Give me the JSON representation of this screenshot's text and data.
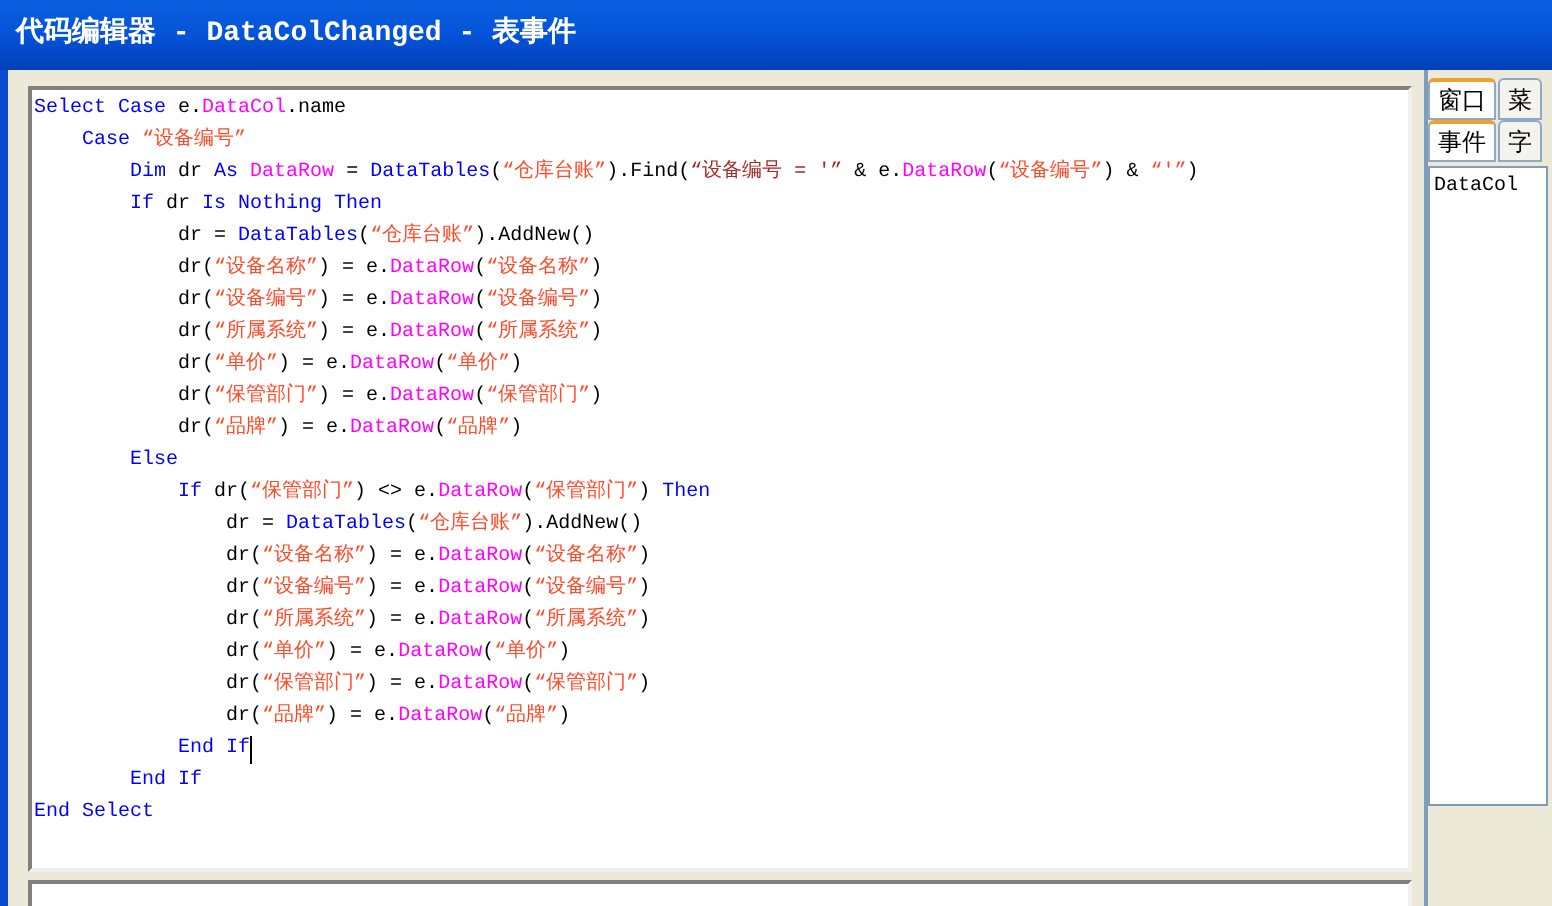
{
  "window": {
    "title": "代码编辑器 - DataColChanged - 表事件"
  },
  "code": [
    {
      "tokens": [
        {
          "kind": "kw",
          "text": "Select Case"
        },
        {
          "kind": "plain",
          "text": " e."
        },
        {
          "kind": "type",
          "text": "DataCol"
        },
        {
          "kind": "plain",
          "text": ".name"
        }
      ]
    },
    {
      "tokens": [
        {
          "kind": "kw",
          "text": "    Case "
        },
        {
          "kind": "str",
          "text": "“设备编号”"
        }
      ]
    },
    {
      "tokens": [
        {
          "kind": "kw",
          "text": "        Dim"
        },
        {
          "kind": "plain",
          "text": " dr "
        },
        {
          "kind": "kw",
          "text": "As "
        },
        {
          "kind": "type",
          "text": "DataRow"
        },
        {
          "kind": "plain",
          "text": " = "
        },
        {
          "kind": "kw",
          "text": "DataTables"
        },
        {
          "kind": "plain",
          "text": "("
        },
        {
          "kind": "str",
          "text": "“仓库台账”"
        },
        {
          "kind": "plain",
          "text": ").Find("
        },
        {
          "kind": "str2",
          "text": "“设备编号 = '”"
        },
        {
          "kind": "plain",
          "text": " & e."
        },
        {
          "kind": "type",
          "text": "DataRow"
        },
        {
          "kind": "plain",
          "text": "("
        },
        {
          "kind": "str",
          "text": "“设备编号”"
        },
        {
          "kind": "plain",
          "text": ") & "
        },
        {
          "kind": "str",
          "text": "“'”"
        },
        {
          "kind": "plain",
          "text": ")"
        }
      ]
    },
    {
      "tokens": [
        {
          "kind": "kw",
          "text": "        If"
        },
        {
          "kind": "plain",
          "text": " dr "
        },
        {
          "kind": "kw",
          "text": "Is Nothing Then"
        }
      ]
    },
    {
      "tokens": [
        {
          "kind": "plain",
          "text": "            dr = "
        },
        {
          "kind": "kw",
          "text": "DataTables"
        },
        {
          "kind": "plain",
          "text": "("
        },
        {
          "kind": "str",
          "text": "“仓库台账”"
        },
        {
          "kind": "plain",
          "text": ").AddNew()"
        }
      ]
    },
    {
      "tokens": [
        {
          "kind": "plain",
          "text": "            dr("
        },
        {
          "kind": "str",
          "text": "“设备名称”"
        },
        {
          "kind": "plain",
          "text": ") = e."
        },
        {
          "kind": "type",
          "text": "DataRow"
        },
        {
          "kind": "plain",
          "text": "("
        },
        {
          "kind": "str",
          "text": "“设备名称”"
        },
        {
          "kind": "plain",
          "text": ")"
        }
      ]
    },
    {
      "tokens": [
        {
          "kind": "plain",
          "text": "            dr("
        },
        {
          "kind": "str",
          "text": "“设备编号”"
        },
        {
          "kind": "plain",
          "text": ") = e."
        },
        {
          "kind": "type",
          "text": "DataRow"
        },
        {
          "kind": "plain",
          "text": "("
        },
        {
          "kind": "str",
          "text": "“设备编号”"
        },
        {
          "kind": "plain",
          "text": ")"
        }
      ]
    },
    {
      "tokens": [
        {
          "kind": "plain",
          "text": "            dr("
        },
        {
          "kind": "str",
          "text": "“所属系统”"
        },
        {
          "kind": "plain",
          "text": ") = e."
        },
        {
          "kind": "type",
          "text": "DataRow"
        },
        {
          "kind": "plain",
          "text": "("
        },
        {
          "kind": "str",
          "text": "“所属系统”"
        },
        {
          "kind": "plain",
          "text": ")"
        }
      ]
    },
    {
      "tokens": [
        {
          "kind": "plain",
          "text": "            dr("
        },
        {
          "kind": "str",
          "text": "“单价”"
        },
        {
          "kind": "plain",
          "text": ") = e."
        },
        {
          "kind": "type",
          "text": "DataRow"
        },
        {
          "kind": "plain",
          "text": "("
        },
        {
          "kind": "str",
          "text": "“单价”"
        },
        {
          "kind": "plain",
          "text": ")"
        }
      ]
    },
    {
      "tokens": [
        {
          "kind": "plain",
          "text": "            dr("
        },
        {
          "kind": "str",
          "text": "“保管部门”"
        },
        {
          "kind": "plain",
          "text": ") = e."
        },
        {
          "kind": "type",
          "text": "DataRow"
        },
        {
          "kind": "plain",
          "text": "("
        },
        {
          "kind": "str",
          "text": "“保管部门”"
        },
        {
          "kind": "plain",
          "text": ")"
        }
      ]
    },
    {
      "tokens": [
        {
          "kind": "plain",
          "text": "            dr("
        },
        {
          "kind": "str",
          "text": "“品牌”"
        },
        {
          "kind": "plain",
          "text": ") = e."
        },
        {
          "kind": "type",
          "text": "DataRow"
        },
        {
          "kind": "plain",
          "text": "("
        },
        {
          "kind": "str",
          "text": "“品牌”"
        },
        {
          "kind": "plain",
          "text": ")"
        }
      ]
    },
    {
      "tokens": [
        {
          "kind": "kw",
          "text": "        Else"
        }
      ]
    },
    {
      "tokens": [
        {
          "kind": "kw",
          "text": "            If"
        },
        {
          "kind": "plain",
          "text": " dr("
        },
        {
          "kind": "str",
          "text": "“保管部门”"
        },
        {
          "kind": "plain",
          "text": ") <> e."
        },
        {
          "kind": "type",
          "text": "DataRow"
        },
        {
          "kind": "plain",
          "text": "("
        },
        {
          "kind": "str",
          "text": "“保管部门”"
        },
        {
          "kind": "plain",
          "text": ") "
        },
        {
          "kind": "kw",
          "text": "Then"
        }
      ]
    },
    {
      "tokens": [
        {
          "kind": "plain",
          "text": "                dr = "
        },
        {
          "kind": "kw",
          "text": "DataTables"
        },
        {
          "kind": "plain",
          "text": "("
        },
        {
          "kind": "str",
          "text": "“仓库台账”"
        },
        {
          "kind": "plain",
          "text": ").AddNew()"
        }
      ]
    },
    {
      "tokens": [
        {
          "kind": "plain",
          "text": "                dr("
        },
        {
          "kind": "str",
          "text": "“设备名称”"
        },
        {
          "kind": "plain",
          "text": ") = e."
        },
        {
          "kind": "type",
          "text": "DataRow"
        },
        {
          "kind": "plain",
          "text": "("
        },
        {
          "kind": "str",
          "text": "“设备名称”"
        },
        {
          "kind": "plain",
          "text": ")"
        }
      ]
    },
    {
      "tokens": [
        {
          "kind": "plain",
          "text": "                dr("
        },
        {
          "kind": "str",
          "text": "“设备编号”"
        },
        {
          "kind": "plain",
          "text": ") = e."
        },
        {
          "kind": "type",
          "text": "DataRow"
        },
        {
          "kind": "plain",
          "text": "("
        },
        {
          "kind": "str",
          "text": "“设备编号”"
        },
        {
          "kind": "plain",
          "text": ")"
        }
      ]
    },
    {
      "tokens": [
        {
          "kind": "plain",
          "text": "                dr("
        },
        {
          "kind": "str",
          "text": "“所属系统”"
        },
        {
          "kind": "plain",
          "text": ") = e."
        },
        {
          "kind": "type",
          "text": "DataRow"
        },
        {
          "kind": "plain",
          "text": "("
        },
        {
          "kind": "str",
          "text": "“所属系统”"
        },
        {
          "kind": "plain",
          "text": ")"
        }
      ]
    },
    {
      "tokens": [
        {
          "kind": "plain",
          "text": "                dr("
        },
        {
          "kind": "str",
          "text": "“单价”"
        },
        {
          "kind": "plain",
          "text": ") = e."
        },
        {
          "kind": "type",
          "text": "DataRow"
        },
        {
          "kind": "plain",
          "text": "("
        },
        {
          "kind": "str",
          "text": "“单价”"
        },
        {
          "kind": "plain",
          "text": ")"
        }
      ]
    },
    {
      "tokens": [
        {
          "kind": "plain",
          "text": "                dr("
        },
        {
          "kind": "str",
          "text": "“保管部门”"
        },
        {
          "kind": "plain",
          "text": ") = e."
        },
        {
          "kind": "type",
          "text": "DataRow"
        },
        {
          "kind": "plain",
          "text": "("
        },
        {
          "kind": "str",
          "text": "“保管部门”"
        },
        {
          "kind": "plain",
          "text": ")"
        }
      ]
    },
    {
      "tokens": [
        {
          "kind": "plain",
          "text": "                dr("
        },
        {
          "kind": "str",
          "text": "“品牌”"
        },
        {
          "kind": "plain",
          "text": ") = e."
        },
        {
          "kind": "type",
          "text": "DataRow"
        },
        {
          "kind": "plain",
          "text": "("
        },
        {
          "kind": "str",
          "text": "“品牌”"
        },
        {
          "kind": "plain",
          "text": ")"
        }
      ]
    },
    {
      "tokens": [
        {
          "kind": "kw",
          "text": "            End If"
        }
      ],
      "cursor": true
    },
    {
      "tokens": [
        {
          "kind": "kw",
          "text": "        End If"
        }
      ]
    },
    {
      "tokens": [
        {
          "kind": "kw",
          "text": "End Select"
        }
      ]
    }
  ],
  "side_tabs_top": [
    {
      "label": "窗口",
      "selected": true
    },
    {
      "label": "菜",
      "selected": false
    }
  ],
  "side_tabs_bottom": [
    {
      "label": "事件",
      "selected": true
    },
    {
      "label": "字",
      "selected": false
    }
  ],
  "event_list": [
    "DataCol"
  ]
}
